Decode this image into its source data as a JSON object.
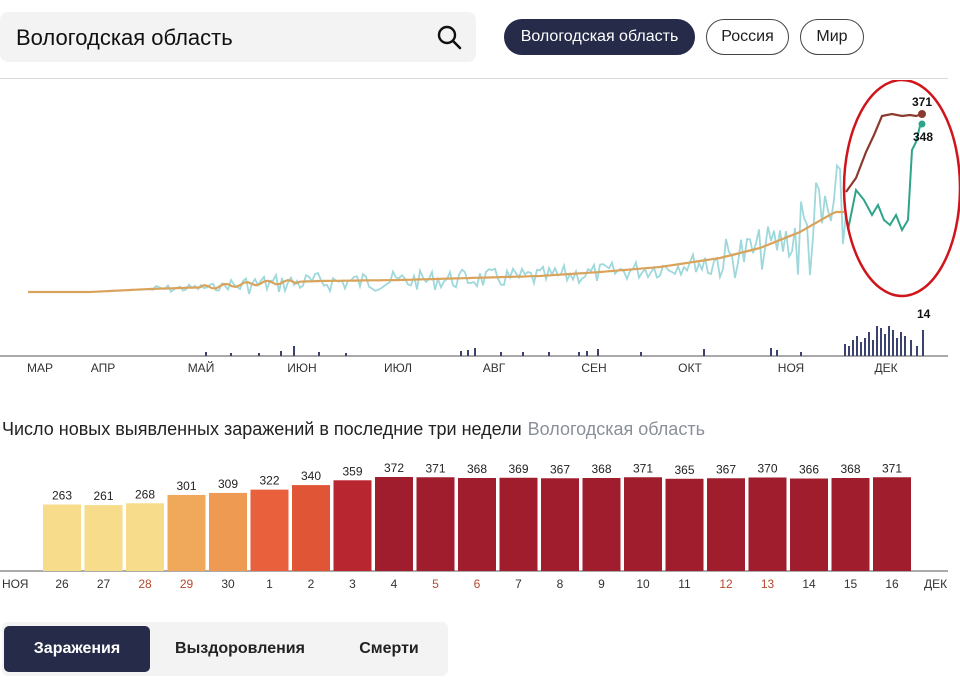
{
  "search": {
    "value": "Вологодская область"
  },
  "region_tabs": [
    {
      "label": "Вологодская область",
      "active": true
    },
    {
      "label": "Россия",
      "active": false
    },
    {
      "label": "Мир",
      "active": false
    }
  ],
  "main_chart": {
    "month_labels": [
      "МАР",
      "АПР",
      "МАЙ",
      "ИЮН",
      "ИЮЛ",
      "АВГ",
      "СЕН",
      "ОКТ",
      "НОЯ",
      "ДЕК"
    ],
    "end_label_average": "371",
    "end_label_daily": "348",
    "end_label_deaths": "14",
    "colors": {
      "average": "#d9a35b",
      "average_recent": "#8b3a2e",
      "daily": "#9fd8dc",
      "daily_recent": "#2ea489",
      "deaths": "#3c4270",
      "highlight": "#d0141c"
    }
  },
  "bar_section": {
    "title": "Число новых выявленных заражений в последние три недели",
    "region": "Вологодская область",
    "start_label": "НОЯ",
    "end_label": "ДЕК",
    "chart_data": {
      "type": "bar",
      "categories": [
        "26",
        "27",
        "28",
        "29",
        "30",
        "1",
        "2",
        "3",
        "4",
        "5",
        "6",
        "7",
        "8",
        "9",
        "10",
        "11",
        "12",
        "13",
        "14",
        "15",
        "16"
      ],
      "values": [
        263,
        261,
        268,
        301,
        309,
        322,
        340,
        359,
        372,
        371,
        368,
        369,
        367,
        368,
        371,
        365,
        367,
        370,
        366,
        368,
        371
      ],
      "weekend": [
        false,
        false,
        true,
        true,
        false,
        false,
        false,
        false,
        false,
        true,
        true,
        false,
        false,
        false,
        false,
        false,
        true,
        true,
        false,
        false,
        false
      ],
      "colors": [
        "#f6dc8b",
        "#f6dc8b",
        "#f6dc8b",
        "#f0a85a",
        "#ee9a52",
        "#e8613c",
        "#e05535",
        "#b8262f",
        "#9f1d2c",
        "#9f1d2c",
        "#9f1d2c",
        "#9f1d2c",
        "#9f1d2c",
        "#9f1d2c",
        "#9f1d2c",
        "#9f1d2c",
        "#9f1d2c",
        "#9f1d2c",
        "#9f1d2c",
        "#9f1d2c",
        "#9f1d2c"
      ],
      "title": "",
      "xlabel": "",
      "ylabel": ""
    }
  },
  "bottom_tabs": [
    {
      "label": "Заражения",
      "active": true
    },
    {
      "label": "Выздоровления",
      "active": false
    },
    {
      "label": "Смерти",
      "active": false
    }
  ]
}
